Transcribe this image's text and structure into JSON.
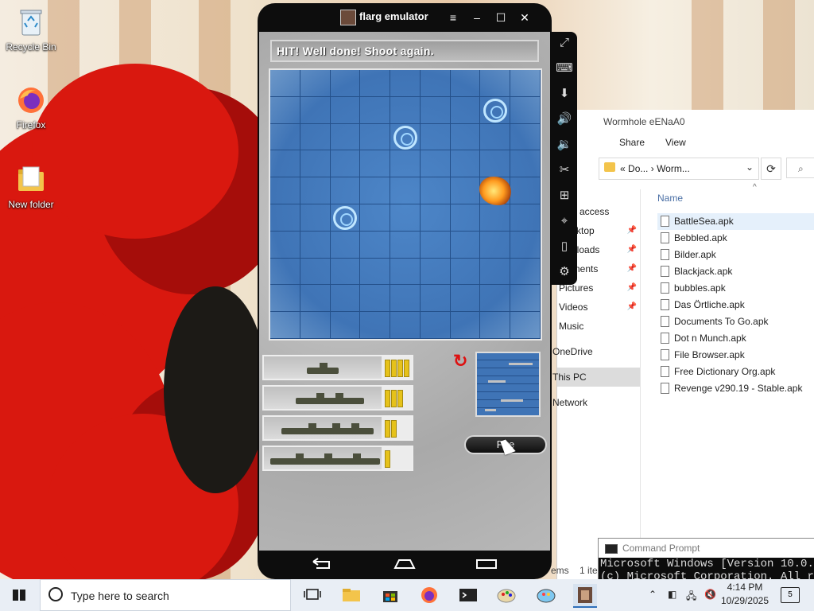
{
  "desktop": {
    "icons": [
      {
        "label": "Recycle Bin",
        "icon": "recycle-bin-icon"
      },
      {
        "label": "Firefox",
        "icon": "firefox-icon"
      },
      {
        "label": "New folder",
        "icon": "folder-icon"
      }
    ]
  },
  "emulator": {
    "title": "flarg emulator",
    "controls": {
      "menu": "≡",
      "minimize": "–",
      "maximize": "☐",
      "close": "✕"
    },
    "side_tools": [
      "fullscreen-icon",
      "keyboard-icon",
      "apk-install-icon",
      "volume-up-icon",
      "volume-down-icon",
      "scissors-icon",
      "add-window-icon",
      "location-icon",
      "rotate-icon",
      "settings-icon"
    ]
  },
  "game": {
    "message": "HIT! Well done! Shoot again.",
    "grid": {
      "cols": 9,
      "rows": 10
    },
    "misses": [
      {
        "col": 7,
        "row": 1
      },
      {
        "col": 4,
        "row": 2
      },
      {
        "col": 2,
        "row": 5
      }
    ],
    "hits": [
      {
        "col": 7,
        "row": 4
      }
    ],
    "fleet": [
      {
        "name": "patrol-boat",
        "ammo": 4,
        "ammo_max": 4
      },
      {
        "name": "destroyer",
        "ammo": 3,
        "ammo_max": 4
      },
      {
        "name": "cruiser",
        "ammo": 2,
        "ammo_max": 4
      },
      {
        "name": "battleship",
        "ammo": 1,
        "ammo_max": 4
      }
    ],
    "fire_label": "Fire"
  },
  "explorer": {
    "title": "Wormhole eENaA0",
    "ribbon": [
      "Share",
      "View"
    ],
    "address": {
      "part1": "Do...",
      "separator": "›",
      "part2": "Worm...",
      "prefix": "«"
    },
    "search_placeholder": "",
    "column_name": "Name",
    "nav": [
      {
        "label": "access",
        "pinned": false
      },
      {
        "label": "ktop",
        "pinned": true
      },
      {
        "label": "nloads",
        "pinned": true
      },
      {
        "label": "uments",
        "pinned": true
      },
      {
        "label": "Pictures",
        "pinned": true
      },
      {
        "label": "Videos",
        "pinned": true
      },
      {
        "label": "Music",
        "pinned": false
      },
      {
        "label": "OneDrive",
        "pinned": false
      },
      {
        "label": "This PC",
        "pinned": false,
        "selected": true
      },
      {
        "label": "Network",
        "pinned": false
      }
    ],
    "files": [
      "BattleSea.apk",
      "Bebbled.apk",
      "Bilder.apk",
      "Blackjack.apk",
      "bubbles.apk",
      "Das Örtliche.apk",
      "Documents To Go.apk",
      "Dot n Munch.apk",
      "File Browser.apk",
      "Free Dictionary Org.apk",
      "Revenge v290.19 - Stable.apk"
    ],
    "selected_file": "BattleSea.apk",
    "status": {
      "items": "ems",
      "selected": "1 ite"
    }
  },
  "cmd": {
    "title": "Command Prompt",
    "lines": [
      "Microsoft Windows [Version 10.0.19",
      "(c) Microsoft Corporation. All ri"
    ]
  },
  "taskbar": {
    "search_placeholder": "Type here to search",
    "apps": [
      "task-view-icon",
      "file-explorer-icon",
      "store-icon",
      "firefox-icon",
      "terminal-icon",
      "paint-icon",
      "paint3d-icon",
      "flarg-icon"
    ],
    "time": "4:14 PM",
    "date": "10/29/2025",
    "notifications": "5"
  },
  "colors": {
    "sea": "#3f74b6",
    "grid_line": "#24508a",
    "hit": "#ff9b1f",
    "accent": "#2f6fba"
  }
}
